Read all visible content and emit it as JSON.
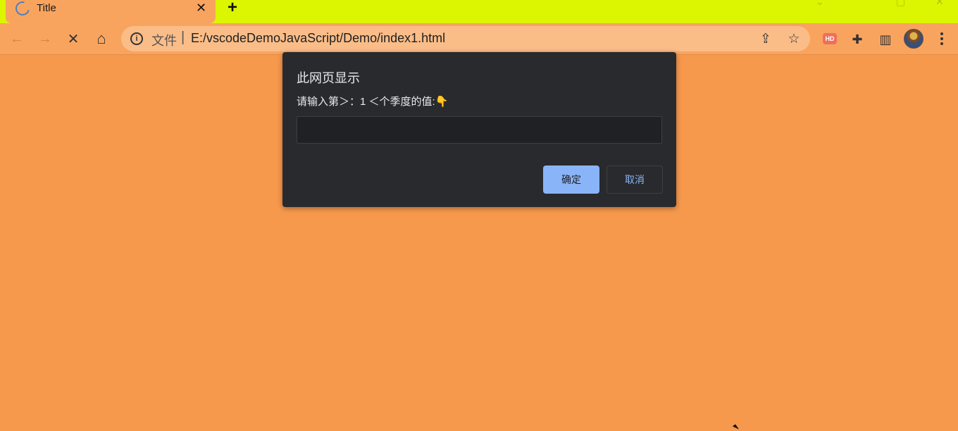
{
  "tab": {
    "title": "Title",
    "close_icon": "✕",
    "new_tab_icon": "+"
  },
  "toolbar": {
    "back_icon": "←",
    "forward_icon": "→",
    "stop_icon": "✕",
    "home_icon": "⌂",
    "info_icon": "i",
    "scheme_label": "文件",
    "separator": "|",
    "url": "E:/vscodeDemoJavaScript/Demo/index1.html",
    "share_icon": "⇪",
    "star_icon": "☆",
    "hd_badge": "HD",
    "extensions_icon": "✚",
    "sidepanel_icon": "▥"
  },
  "dialog": {
    "title": "此网页显示",
    "message": "请输入第＞：1 ＜个季度的值:👇",
    "input_value": "",
    "ok_label": "确定",
    "cancel_label": "取消"
  },
  "colors": {
    "page_background": "#f7994d",
    "tabbar": "#dcf500",
    "dialog_background": "#292a2d",
    "ok_button": "#8ab4f8"
  }
}
